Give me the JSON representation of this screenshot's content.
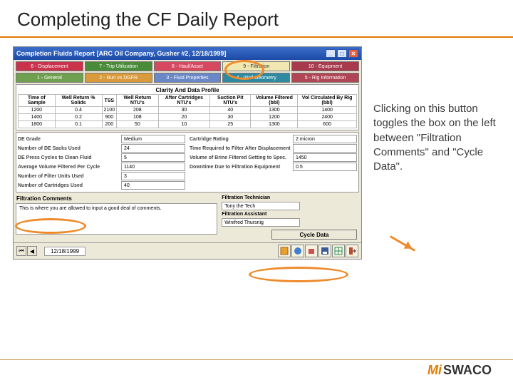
{
  "slide_title": "Completing the CF Daily Report",
  "annotation": "Clicking on this button toggles the box on the left between \"Filtration Comments\" and \"Cycle Data\".",
  "window": {
    "title": "Completion Fluids Report [ARC Oil Company, Gusher #2, 12/18/1999]",
    "tabs_top": [
      "6 - Displacement",
      "7 - Trip Utilization",
      "8 - Haul/Asset",
      "9 - Filtration",
      "10 - Equipment"
    ],
    "tabs_bottom": [
      "1 - General",
      "2 - Run vs DGFR",
      "3 - Fluid Properties",
      "4 - Well Geometry",
      "5 - Rig Information"
    ],
    "section_title": "Clarity And Data Profile",
    "grid": {
      "headers": [
        "Time of Sample",
        "Well Return % Solids",
        "TSS",
        "Well Return NTU's",
        "After Cartridges NTU's",
        "Suction Pit NTU's",
        "Volume Filtered (bbl)",
        "Vol Circulated By Rig (bbl)"
      ],
      "rows": [
        [
          "1200",
          "0.4",
          "2100",
          "208",
          "30",
          "40",
          "1300",
          "1400"
        ],
        [
          "1400",
          "0.2",
          "900",
          "108",
          "20",
          "30",
          "1200",
          "2400"
        ],
        [
          "1800",
          "0.1",
          "200",
          "50",
          "10",
          "25",
          "1300",
          "600"
        ]
      ]
    },
    "left_fields": [
      {
        "label": "DE Grade",
        "value": "Medium"
      },
      {
        "label": "Number of DE Sacks Used",
        "value": "24"
      },
      {
        "label": "DE Press Cycles to Clean Fluid",
        "value": "5"
      },
      {
        "label": "Average Volume Filtered Per Cycle",
        "value": "1140"
      },
      {
        "label": "Number of Filter Units Used",
        "value": "3"
      },
      {
        "label": "Number of Cartridges Used",
        "value": "40"
      }
    ],
    "right_fields": [
      {
        "label": "Cartridge Rating",
        "value": "2 micron"
      },
      {
        "label": "Time Required to Filter After Displacement",
        "value": ""
      },
      {
        "label": "Volume of Brine Filtered Getting to Spec.",
        "value": "1450"
      },
      {
        "label": "Downtime Due to Filtration Equipment",
        "value": "0.5"
      }
    ],
    "comments_label": "Filtration Comments",
    "comments_text": "This is where you are allowed to input a good deal of comments.",
    "tech_label": "Filtration Technician",
    "tech_value": "Tony the Tech",
    "asst_label": "Filtration Assistant",
    "asst_value": "Winifred Thursnig",
    "cycle_btn": "Cycle Data",
    "date": "12/18/1999"
  },
  "logo": {
    "brand": "SWACO",
    "mi": "Mi"
  }
}
